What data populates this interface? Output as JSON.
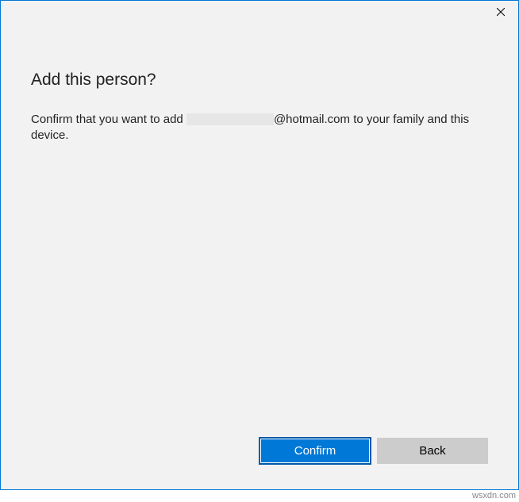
{
  "titlebar": {
    "close_icon": "close"
  },
  "dialog": {
    "heading": "Add this person?",
    "body_prefix": "Confirm that you want to add ",
    "body_suffix": "@hotmail.com to your family and this device."
  },
  "buttons": {
    "confirm_label": "Confirm",
    "back_label": "Back"
  },
  "watermark": "wsxdn.com"
}
